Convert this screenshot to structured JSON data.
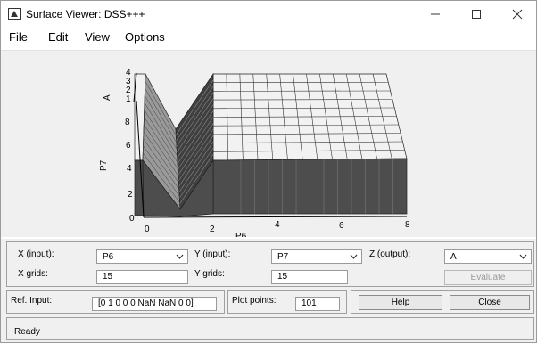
{
  "window": {
    "title": "Surface Viewer: DSS+++"
  },
  "menu": [
    "File",
    "Edit",
    "View",
    "Options"
  ],
  "plot": {
    "z_label": "A",
    "x_label": "P6",
    "y_label": "P7",
    "x_ticks": [
      "0",
      "2",
      "4",
      "6",
      "8"
    ],
    "y_ticks": [
      "0",
      "2",
      "4",
      "6",
      "8"
    ],
    "z_ticks": [
      "1",
      "2",
      "3",
      "4"
    ],
    "surface_color": "#f2f2f2",
    "side_color": "#4d4d4d"
  },
  "inputs": {
    "x_input_label": "X (input):",
    "x_input_value": "P6",
    "y_input_label": "Y (input):",
    "y_input_value": "P7",
    "z_output_label": "Z (output):",
    "z_output_value": "A",
    "x_grids_label": "X grids:",
    "x_grids_value": "15",
    "y_grids_label": "Y grids:",
    "y_grids_value": "15",
    "evaluate_label": "Evaluate",
    "ref_input_label": "Ref. Input:",
    "ref_input_value": "[0 1 0 0 0 NaN NaN 0 0]",
    "plot_points_label": "Plot points:",
    "plot_points_value": "101",
    "help_label": "Help",
    "close_label": "Close"
  },
  "status": {
    "text": "Ready"
  }
}
